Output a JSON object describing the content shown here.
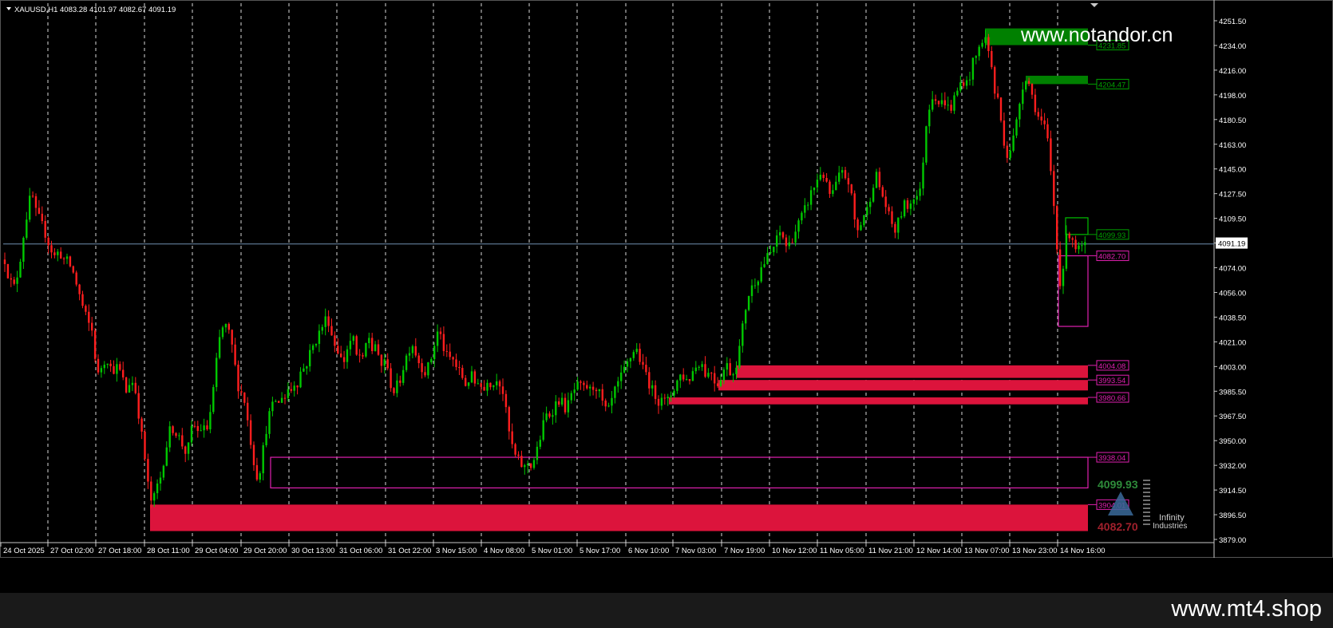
{
  "header": {
    "symbol_tf": "XAUUSD,H1",
    "ohlc": "4083.28 4101.97 4082.67 4091.19"
  },
  "watermarks": {
    "top": "www.notandor.cn",
    "bottom": "www.mt4.shop",
    "logo_line1": "Infinity",
    "logo_line2": "Industries"
  },
  "colors": {
    "background": "#000000",
    "bull": "#00c800",
    "bear": "#ff1e1e",
    "supply_zone": "#008000",
    "demand_zone": "#dc143c",
    "outline_zone": "#e020b0",
    "price_line": "#7090b0",
    "grid": "#ffffff"
  },
  "chart_data": {
    "type": "candlestick",
    "symbol": "XAUUSD",
    "timeframe": "H1",
    "ylim": [
      3873,
      4262
    ],
    "y_ticks": [
      "4251.50",
      "4234.00",
      "4216.00",
      "4198.00",
      "4180.50",
      "4163.00",
      "4145.00",
      "4127.50",
      "4109.50",
      "4091.19",
      "4074.00",
      "4056.00",
      "4038.50",
      "4021.00",
      "4003.00",
      "3985.50",
      "3967.50",
      "3950.00",
      "3932.00",
      "3914.50",
      "3896.50",
      "3879.00"
    ],
    "current_price": "4091.19",
    "x_ticks": [
      "24 Oct 2025",
      "27 Oct 02:00",
      "27 Oct 18:00",
      "28 Oct 11:00",
      "29 Oct 04:00",
      "29 Oct 20:00",
      "30 Oct 13:00",
      "31 Oct 06:00",
      "31 Oct 22:00",
      "3 Nov 15:00",
      "4 Nov 08:00",
      "5 Nov 01:00",
      "5 Nov 17:00",
      "6 Nov 10:00",
      "7 Nov 03:00",
      "7 Nov 19:00",
      "10 Nov 12:00",
      "11 Nov 05:00",
      "11 Nov 21:00",
      "12 Nov 14:00",
      "13 Nov 07:00",
      "13 Nov 23:00",
      "14 Nov 16:00"
    ],
    "close_path": [
      [
        0,
        4095
      ],
      [
        6,
        4080
      ],
      [
        12,
        4065
      ],
      [
        18,
        4060
      ],
      [
        24,
        4075
      ],
      [
        30,
        4100
      ],
      [
        36,
        4120
      ],
      [
        40,
        4128
      ],
      [
        44,
        4115
      ],
      [
        50,
        4108
      ],
      [
        56,
        4100
      ],
      [
        62,
        4090
      ],
      [
        68,
        4082
      ],
      [
        74,
        4086
      ],
      [
        80,
        4080
      ],
      [
        86,
        4078
      ],
      [
        92,
        4070
      ],
      [
        98,
        4058
      ],
      [
        104,
        4045
      ],
      [
        110,
        4035
      ],
      [
        116,
        4028
      ],
      [
        122,
        3995
      ],
      [
        128,
        4005
      ],
      [
        134,
        4010
      ],
      [
        140,
        4000
      ],
      [
        146,
        4003
      ],
      [
        152,
        3998
      ],
      [
        158,
        3985
      ],
      [
        164,
        3995
      ],
      [
        170,
        3985
      ],
      [
        176,
        3960
      ],
      [
        182,
        3935
      ],
      [
        186,
        3915
      ],
      [
        190,
        3905
      ],
      [
        194,
        3910
      ],
      [
        198,
        3920
      ],
      [
        202,
        3925
      ],
      [
        206,
        3940
      ],
      [
        210,
        3950
      ],
      [
        214,
        3960
      ],
      [
        218,
        3958
      ],
      [
        222,
        3955
      ],
      [
        226,
        3950
      ],
      [
        230,
        3945
      ],
      [
        234,
        3940
      ],
      [
        238,
        3950
      ],
      [
        242,
        3965
      ],
      [
        246,
        3955
      ],
      [
        250,
        3958
      ],
      [
        254,
        3960
      ],
      [
        258,
        3955
      ],
      [
        262,
        3965
      ],
      [
        266,
        3980
      ],
      [
        270,
        4000
      ],
      [
        274,
        4020
      ],
      [
        278,
        4030
      ],
      [
        282,
        4033
      ],
      [
        286,
        4028
      ],
      [
        290,
        4020
      ],
      [
        294,
        4005
      ],
      [
        298,
        3990
      ],
      [
        302,
        3985
      ],
      [
        306,
        3980
      ],
      [
        310,
        3965
      ],
      [
        314,
        3950
      ],
      [
        318,
        3935
      ],
      [
        322,
        3925
      ],
      [
        326,
        3930
      ],
      [
        330,
        3945
      ],
      [
        334,
        3960
      ],
      [
        338,
        3970
      ],
      [
        342,
        3975
      ],
      [
        346,
        3980
      ],
      [
        350,
        3975
      ],
      [
        354,
        3985
      ],
      [
        358,
        3980
      ],
      [
        362,
        3990
      ],
      [
        366,
        3985
      ],
      [
        370,
        3995
      ],
      [
        374,
        3990
      ],
      [
        378,
        4005
      ],
      [
        382,
        4000
      ],
      [
        386,
        4010
      ],
      [
        390,
        4015
      ],
      [
        394,
        4020
      ],
      [
        398,
        4025
      ],
      [
        402,
        4030
      ],
      [
        406,
        4035
      ],
      [
        410,
        4040
      ],
      [
        414,
        4030
      ],
      [
        418,
        4020
      ],
      [
        422,
        4018
      ],
      [
        426,
        4010
      ],
      [
        430,
        4005
      ],
      [
        434,
        4015
      ],
      [
        438,
        4020
      ],
      [
        442,
        4025
      ],
      [
        446,
        4010
      ],
      [
        450,
        4012
      ],
      [
        454,
        4005
      ],
      [
        458,
        4018
      ],
      [
        462,
        4025
      ],
      [
        466,
        4015
      ],
      [
        470,
        4020
      ],
      [
        474,
        4008
      ],
      [
        478,
        4003
      ],
      [
        482,
        4010
      ],
      [
        486,
        3998
      ],
      [
        490,
        3990
      ],
      [
        494,
        3985
      ],
      [
        498,
        3990
      ],
      [
        502,
        3995
      ],
      [
        506,
        4005
      ],
      [
        510,
        4012
      ],
      [
        514,
        4018
      ],
      [
        518,
        4020
      ],
      [
        522,
        4010
      ],
      [
        526,
        4005
      ],
      [
        530,
        4002
      ],
      [
        534,
        3998
      ],
      [
        538,
        4006
      ],
      [
        542,
        4012
      ],
      [
        546,
        4025
      ],
      [
        550,
        4030
      ],
      [
        554,
        4020
      ],
      [
        558,
        4012
      ],
      [
        562,
        4008
      ],
      [
        566,
        4010
      ],
      [
        570,
        4005
      ],
      [
        574,
        4000
      ],
      [
        578,
        3998
      ],
      [
        582,
        3990
      ],
      [
        586,
        3992
      ],
      [
        590,
        3998
      ],
      [
        594,
        3990
      ],
      [
        598,
        3995
      ],
      [
        602,
        3990
      ],
      [
        606,
        3985
      ],
      [
        610,
        3995
      ],
      [
        614,
        3992
      ],
      [
        618,
        3990
      ],
      [
        622,
        3996
      ],
      [
        626,
        3992
      ],
      [
        630,
        3985
      ],
      [
        634,
        3970
      ],
      [
        638,
        3955
      ],
      [
        642,
        3945
      ],
      [
        646,
        3938
      ],
      [
        650,
        3935
      ],
      [
        654,
        3932
      ],
      [
        658,
        3930
      ],
      [
        662,
        3935
      ],
      [
        666,
        3932
      ],
      [
        670,
        3938
      ],
      [
        674,
        3945
      ],
      [
        678,
        3955
      ],
      [
        682,
        3965
      ],
      [
        686,
        3970
      ],
      [
        690,
        3968
      ],
      [
        694,
        3975
      ],
      [
        698,
        3978
      ],
      [
        702,
        3980
      ],
      [
        706,
        3975
      ],
      [
        710,
        3972
      ],
      [
        714,
        3980
      ],
      [
        718,
        3985
      ],
      [
        722,
        3988
      ],
      [
        726,
        3990
      ],
      [
        730,
        3985
      ],
      [
        734,
        3990
      ],
      [
        738,
        3985
      ],
      [
        742,
        3988
      ],
      [
        746,
        3990
      ],
      [
        750,
        3985
      ],
      [
        754,
        3978
      ],
      [
        758,
        3972
      ],
      [
        762,
        3970
      ],
      [
        766,
        3978
      ],
      [
        770,
        3985
      ],
      [
        774,
        3990
      ],
      [
        778,
        3995
      ],
      [
        782,
        4000
      ],
      [
        786,
        4005
      ],
      [
        790,
        4010
      ],
      [
        794,
        4015
      ],
      [
        798,
        4015
      ],
      [
        802,
        4008
      ],
      [
        806,
        4000
      ],
      [
        810,
        3998
      ],
      [
        814,
        3990
      ],
      [
        818,
        3985
      ],
      [
        822,
        3982
      ],
      [
        826,
        3978
      ],
      [
        830,
        3985
      ],
      [
        834,
        3975
      ],
      [
        838,
        3980
      ],
      [
        842,
        3985
      ],
      [
        846,
        3990
      ],
      [
        850,
        3995
      ],
      [
        854,
        3998
      ],
      [
        858,
        3995
      ],
      [
        862,
        3992
      ],
      [
        866,
        3998
      ],
      [
        870,
        4002
      ],
      [
        874,
        4005
      ],
      [
        878,
        4008
      ],
      [
        882,
        4000
      ],
      [
        886,
        3996
      ],
      [
        890,
        4002
      ],
      [
        894,
        3995
      ],
      [
        898,
        3990
      ],
      [
        902,
        3995
      ],
      [
        906,
        4000
      ],
      [
        910,
        4005
      ],
      [
        914,
        4000
      ],
      [
        918,
        3998
      ],
      [
        922,
        4005
      ],
      [
        926,
        4015
      ],
      [
        930,
        4030
      ],
      [
        934,
        4045
      ],
      [
        938,
        4055
      ],
      [
        942,
        4060
      ],
      [
        946,
        4065
      ],
      [
        950,
        4068
      ],
      [
        954,
        4075
      ],
      [
        958,
        4078
      ],
      [
        962,
        4082
      ],
      [
        966,
        4085
      ],
      [
        970,
        4090
      ],
      [
        974,
        4095
      ],
      [
        978,
        4100
      ],
      [
        982,
        4095
      ],
      [
        986,
        4088
      ],
      [
        990,
        4092
      ],
      [
        994,
        4098
      ],
      [
        998,
        4102
      ],
      [
        1002,
        4108
      ],
      [
        1006,
        4112
      ],
      [
        1010,
        4118
      ],
      [
        1014,
        4125
      ],
      [
        1018,
        4130
      ],
      [
        1022,
        4135
      ],
      [
        1026,
        4140
      ],
      [
        1030,
        4145
      ],
      [
        1034,
        4135
      ],
      [
        1038,
        4128
      ],
      [
        1042,
        4125
      ],
      [
        1046,
        4132
      ],
      [
        1050,
        4138
      ],
      [
        1054,
        4142
      ],
      [
        1058,
        4140
      ],
      [
        1062,
        4138
      ],
      [
        1066,
        4128
      ],
      [
        1070,
        4110
      ],
      [
        1074,
        4100
      ],
      [
        1078,
        4105
      ],
      [
        1082,
        4112
      ],
      [
        1086,
        4115
      ],
      [
        1090,
        4125
      ],
      [
        1094,
        4135
      ],
      [
        1098,
        4140
      ],
      [
        1102,
        4132
      ],
      [
        1106,
        4125
      ],
      [
        1110,
        4118
      ],
      [
        1114,
        4110
      ],
      [
        1118,
        4105
      ],
      [
        1122,
        4100
      ],
      [
        1126,
        4108
      ],
      [
        1130,
        4115
      ],
      [
        1134,
        4120
      ],
      [
        1138,
        4118
      ],
      [
        1142,
        4122
      ],
      [
        1146,
        4128
      ],
      [
        1150,
        4125
      ],
      [
        1154,
        4130
      ],
      [
        1158,
        4165
      ],
      [
        1162,
        4185
      ],
      [
        1166,
        4195
      ],
      [
        1170,
        4200
      ],
      [
        1174,
        4195
      ],
      [
        1178,
        4190
      ],
      [
        1182,
        4195
      ],
      [
        1186,
        4192
      ],
      [
        1190,
        4185
      ],
      [
        1194,
        4195
      ],
      [
        1198,
        4198
      ],
      [
        1202,
        4205
      ],
      [
        1206,
        4210
      ],
      [
        1210,
        4205
      ],
      [
        1214,
        4210
      ],
      [
        1218,
        4220
      ],
      [
        1222,
        4225
      ],
      [
        1226,
        4230
      ],
      [
        1230,
        4238
      ],
      [
        1234,
        4240
      ],
      [
        1238,
        4230
      ],
      [
        1242,
        4220
      ],
      [
        1246,
        4200
      ],
      [
        1250,
        4195
      ],
      [
        1254,
        4180
      ],
      [
        1258,
        4165
      ],
      [
        1262,
        4155
      ],
      [
        1266,
        4160
      ],
      [
        1270,
        4168
      ],
      [
        1274,
        4180
      ],
      [
        1278,
        4195
      ],
      [
        1282,
        4208
      ],
      [
        1286,
        4212
      ],
      [
        1290,
        4205
      ],
      [
        1294,
        4195
      ],
      [
        1298,
        4188
      ],
      [
        1302,
        4180
      ],
      [
        1306,
        4178
      ],
      [
        1310,
        4172
      ],
      [
        1314,
        4160
      ],
      [
        1318,
        4130
      ],
      [
        1322,
        4110
      ],
      [
        1326,
        4070
      ],
      [
        1330,
        4060
      ],
      [
        1334,
        4090
      ],
      [
        1338,
        4100
      ],
      [
        1342,
        4098
      ],
      [
        1346,
        4092
      ],
      [
        1350,
        4085
      ],
      [
        1354,
        4090
      ],
      [
        1358,
        4088
      ],
      [
        1362,
        4091
      ]
    ],
    "zones": [
      {
        "kind": "supply",
        "style": "filled",
        "top": 4246,
        "bottom": 4234,
        "x_start": 1234,
        "label": "4231.85"
      },
      {
        "kind": "supply",
        "style": "filled",
        "top": 4212,
        "bottom": 4206,
        "x_start": 1285,
        "label": "4204.47"
      },
      {
        "kind": "supply",
        "style": "outline",
        "top": 4110,
        "bottom": 4098,
        "x_start": 1335,
        "label": "4099.93"
      },
      {
        "kind": "demand",
        "style": "outline",
        "top": 4082.7,
        "bottom": 4032,
        "x_start": 1326,
        "label": "4082.70"
      },
      {
        "kind": "demand",
        "style": "filled",
        "top": 4004,
        "bottom": 3995,
        "x_start": 922,
        "label": "4004.08"
      },
      {
        "kind": "demand",
        "style": "filled",
        "top": 3993.5,
        "bottom": 3986,
        "x_start": 900,
        "label": "3993.54"
      },
      {
        "kind": "demand",
        "style": "filled",
        "top": 3981,
        "bottom": 3976,
        "x_start": 838,
        "label": "3980.66"
      },
      {
        "kind": "demand",
        "style": "outline",
        "top": 3938,
        "bottom": 3916,
        "x_start": 339,
        "label": "3938.04"
      },
      {
        "kind": "demand",
        "style": "filled",
        "top": 3904,
        "bottom": 3885,
        "x_start": 188,
        "label": "3904.01"
      }
    ],
    "zone_end_x": 1363,
    "summary_high": "4099.93",
    "summary_low": "4082.70",
    "grid": true
  }
}
